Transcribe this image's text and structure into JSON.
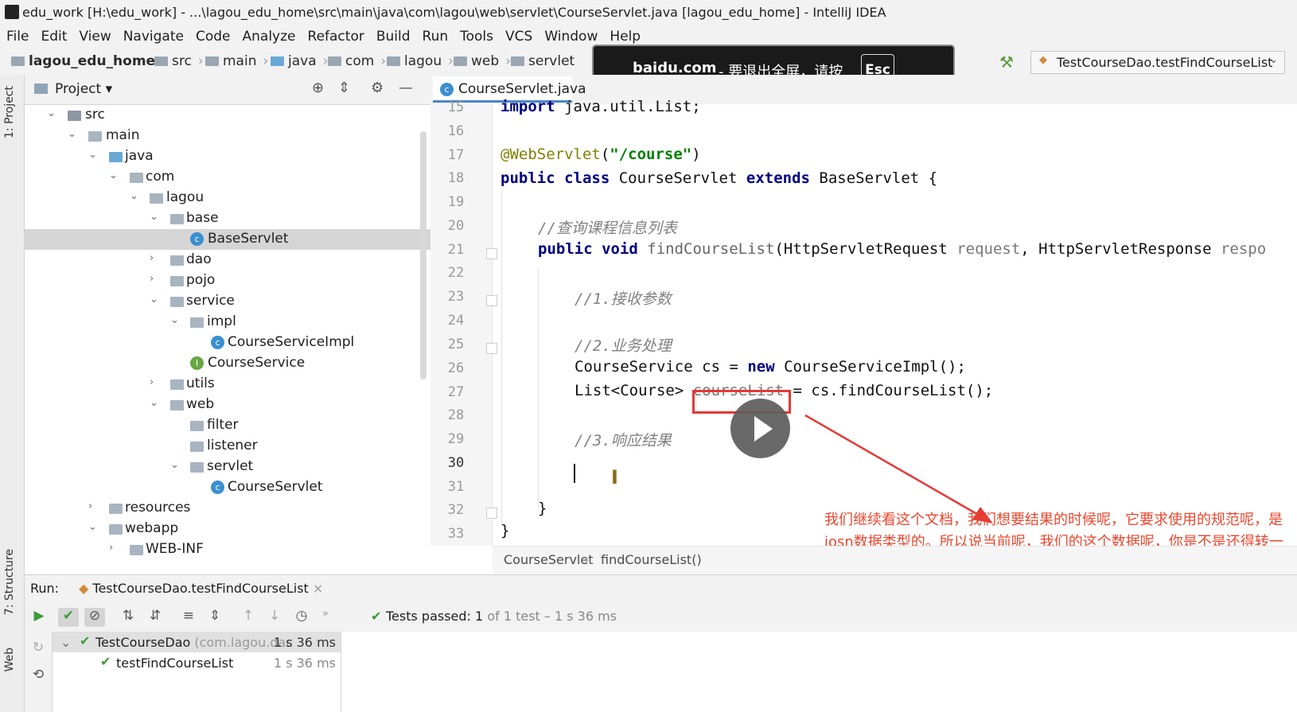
{
  "window": {
    "title": "edu_work [H:\\edu_work] - ...\\lagou_edu_home\\src\\main\\java\\com\\lagou\\web\\servlet\\CourseServlet.java [lagou_edu_home] - IntelliJ IDEA"
  },
  "menu": [
    "File",
    "Edit",
    "View",
    "Navigate",
    "Code",
    "Analyze",
    "Refactor",
    "Build",
    "Run",
    "Tools",
    "VCS",
    "Window",
    "Help"
  ],
  "nav": {
    "crumbs": [
      "lagou_edu_home",
      "src",
      "main",
      "java",
      "com",
      "lagou",
      "web",
      "servlet"
    ],
    "run_config": "TestCourseDao.testFindCourseList"
  },
  "toast": {
    "host": "baidu.com",
    "message": "- 要退出全屏，请按",
    "key": "Esc"
  },
  "side_tabs": {
    "project": "1: Project",
    "structure": "7: Structure",
    "web": "Web"
  },
  "project": {
    "title": "Project",
    "tree": [
      {
        "label": "src",
        "icon": "folder-src",
        "open": true
      },
      {
        "label": "main",
        "icon": "folder",
        "open": true
      },
      {
        "label": "java",
        "icon": "folder-java",
        "open": true
      },
      {
        "label": "com",
        "icon": "package",
        "open": true
      },
      {
        "label": "lagou",
        "icon": "package",
        "open": true
      },
      {
        "label": "base",
        "icon": "package",
        "open": true
      },
      {
        "label": "BaseServlet",
        "icon": "class",
        "selected": true
      },
      {
        "label": "dao",
        "icon": "package",
        "open": false
      },
      {
        "label": "pojo",
        "icon": "package",
        "open": false
      },
      {
        "label": "service",
        "icon": "package",
        "open": true
      },
      {
        "label": "impl",
        "icon": "package",
        "open": true
      },
      {
        "label": "CourseServiceImpl",
        "icon": "class"
      },
      {
        "label": "CourseService",
        "icon": "interface"
      },
      {
        "label": "utils",
        "icon": "package",
        "open": false
      },
      {
        "label": "web",
        "icon": "package",
        "open": true
      },
      {
        "label": "filter",
        "icon": "package"
      },
      {
        "label": "listener",
        "icon": "package"
      },
      {
        "label": "servlet",
        "icon": "package",
        "open": true
      },
      {
        "label": "CourseServlet",
        "icon": "class"
      },
      {
        "label": "resources",
        "icon": "folder",
        "open": false
      },
      {
        "label": "webapp",
        "icon": "folder",
        "open": true
      },
      {
        "label": "WEB-INF",
        "icon": "folder",
        "open": false
      }
    ]
  },
  "editor": {
    "tab": "CourseServlet.java",
    "line_numbers": [
      "15",
      "16",
      "17",
      "18",
      "19",
      "20",
      "21",
      "22",
      "23",
      "24",
      "25",
      "26",
      "27",
      "28",
      "29",
      "30",
      "31",
      "32",
      "33"
    ],
    "current_line": "30",
    "code": {
      "l15_kw": "import",
      "l15_rest": " java.util.List;",
      "l17_ann": "@WebServlet",
      "l17_open": "(",
      "l17_str": "\"/course\"",
      "l17_close": ")",
      "l18_kw1": "public class",
      "l18_name": " CourseServlet ",
      "l18_kw2": "extends",
      "l18_rest": " BaseServlet {",
      "l20_cmt": "//查询课程信息列表",
      "l21_kw": "public void",
      "l21_mth": " findCourseList",
      "l21_a": "(HttpServletRequest ",
      "l21_p1": "request",
      "l21_b": ", HttpServletResponse ",
      "l21_p2": "respo",
      "l23_cmt": "//1.接收参数",
      "l25_cmt": "//2.业务处理",
      "l26_a": "CourseService cs = ",
      "l26_kw": "new",
      "l26_b": " CourseServiceImpl();",
      "l27_a": "List<Course> ",
      "l27_var": "courseList",
      "l27_b": " = cs.findCourseList();",
      "l29_cmt": "//3.响应结果",
      "l32": "}",
      "l33": "}"
    },
    "breadcrumb": [
      "CourseServlet",
      "findCourseList()"
    ]
  },
  "subtitle": "我们继续看这个文档，我们想要结果的时候呢，它要求使用的规范呢，是josn数据类型的。所以说当前呢，我们的这个数据呢，你是不是还得转一下呀？",
  "run": {
    "label": "Run:",
    "tab": "TestCourseDao.testFindCourseList",
    "status_prefix": "Tests passed:",
    "status_count": "1",
    "status_detail": "of 1 test – 1 s 36 ms",
    "tests": [
      {
        "name": "TestCourseDao",
        "pkg": "(com.lagou.dac",
        "time": "1 s 36 ms"
      },
      {
        "name": "testFindCourseList",
        "time": "1 s 36 ms"
      }
    ]
  },
  "colors": {
    "highlight": "#e53935",
    "subtitle": "#e8472f",
    "pass": "#3d9a3d",
    "accent": "#4a88c7"
  }
}
